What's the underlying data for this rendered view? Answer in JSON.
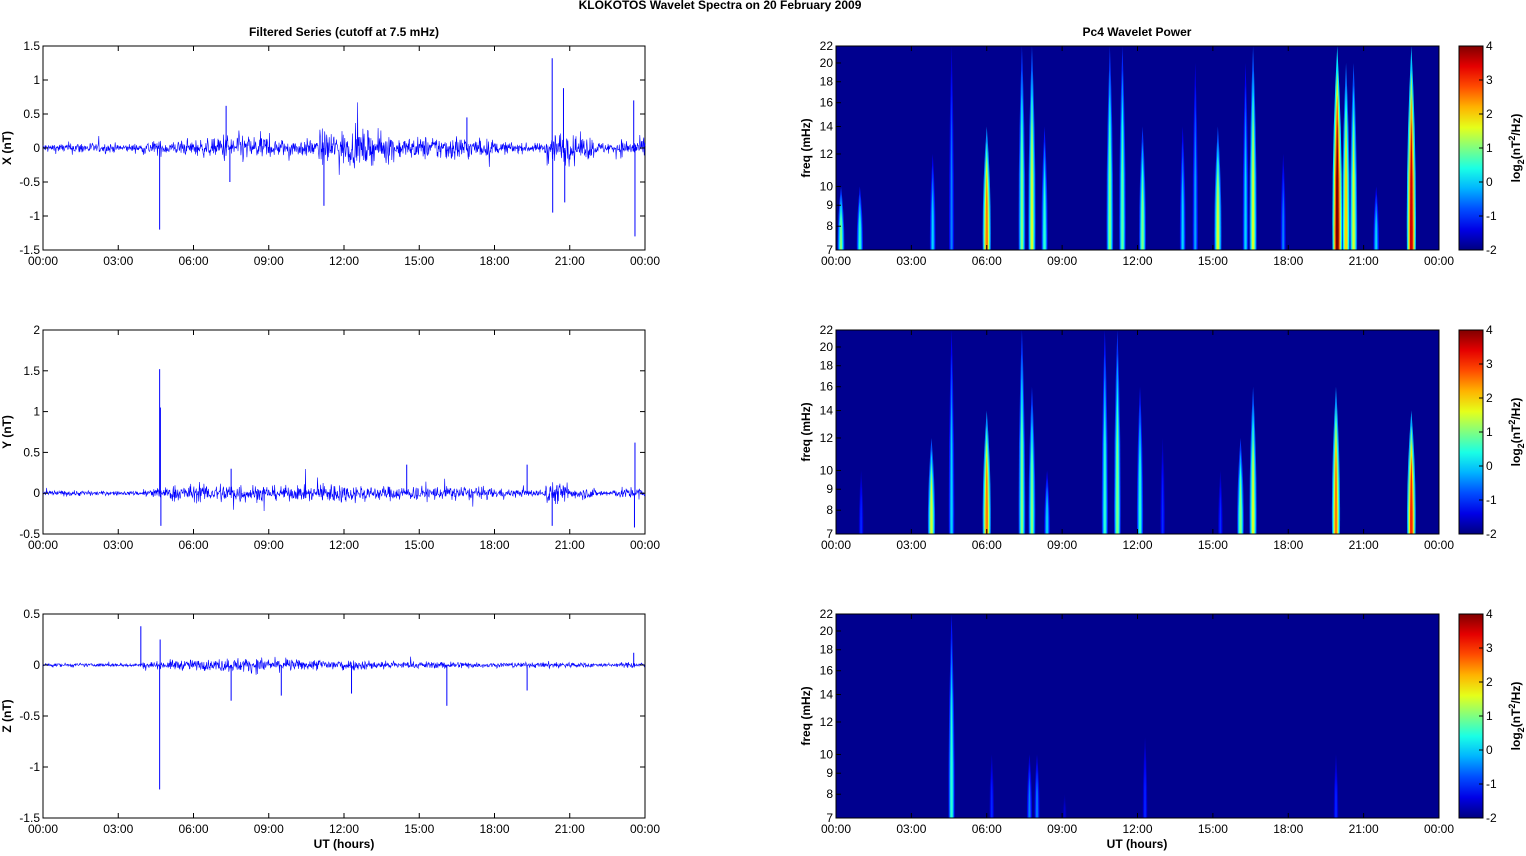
{
  "title": "KLOKOTOS Wavelet Spectra on 20 February  2009",
  "left_title": "Filtered Series (cutoff at 7.5 mHz)",
  "right_title": "Pc4 Wavelet Power",
  "xlabel": "UT (hours)",
  "freq_label": "freq (mHz)",
  "colorbar_label": {
    "a": "log",
    "sub": "2",
    "b": "(nT",
    "sup": "2",
    "c": "/Hz)"
  },
  "colors": {
    "series": "#0000ff",
    "background": "#00008f"
  },
  "chart_data": [
    {
      "type": "line",
      "name": "X",
      "ylabel": "X (nT)",
      "ylim": [
        -1.5,
        1.5
      ],
      "yticks": [
        "-1.5",
        "-1",
        "-0.5",
        "0",
        "0.5",
        "1",
        "1.5"
      ],
      "ytick_values": [
        -1.5,
        -1,
        -0.5,
        0,
        0.5,
        1,
        1.5
      ],
      "xlim": [
        0,
        24
      ],
      "xticks": [
        "00:00",
        "03:00",
        "06:00",
        "09:00",
        "12:00",
        "15:00",
        "18:00",
        "21:00",
        "00:00"
      ],
      "noise_envelope_by_hour": [
        0.08,
        0.1,
        0.08,
        0.07,
        0.12,
        0.12,
        0.15,
        0.25,
        0.22,
        0.15,
        0.15,
        0.3,
        0.3,
        0.25,
        0.18,
        0.2,
        0.22,
        0.15,
        0.1,
        0.08,
        0.28,
        0.2,
        0.1,
        0.15
      ],
      "spikes": [
        [
          4.65,
          -1.2
        ],
        [
          7.3,
          0.62
        ],
        [
          7.45,
          -0.5
        ],
        [
          11.2,
          -0.85
        ],
        [
          16.9,
          0.45
        ],
        [
          20.3,
          1.32
        ],
        [
          20.32,
          -0.95
        ],
        [
          20.75,
          0.88
        ],
        [
          20.8,
          -0.8
        ],
        [
          23.55,
          0.7
        ],
        [
          23.6,
          -1.3
        ]
      ]
    },
    {
      "type": "line",
      "name": "Y",
      "ylabel": "Y (nT)",
      "ylim": [
        -0.5,
        2
      ],
      "yticks": [
        "-0.5",
        "0",
        "0.5",
        "1",
        "1.5",
        "2"
      ],
      "ytick_values": [
        -0.5,
        0,
        0.5,
        1,
        1.5,
        2
      ],
      "xlim": [
        0,
        24
      ],
      "xticks": [
        "00:00",
        "03:00",
        "06:00",
        "09:00",
        "12:00",
        "15:00",
        "18:00",
        "21:00",
        "00:00"
      ],
      "noise_envelope_by_hour": [
        0.04,
        0.04,
        0.03,
        0.03,
        0.08,
        0.12,
        0.12,
        0.15,
        0.12,
        0.1,
        0.1,
        0.15,
        0.12,
        0.1,
        0.1,
        0.1,
        0.1,
        0.08,
        0.06,
        0.05,
        0.15,
        0.08,
        0.05,
        0.08
      ],
      "spikes": [
        [
          4.65,
          1.52
        ],
        [
          4.68,
          1.05
        ],
        [
          4.7,
          -0.4
        ],
        [
          7.5,
          0.3
        ],
        [
          14.5,
          0.35
        ],
        [
          19.3,
          0.35
        ],
        [
          20.3,
          -0.4
        ],
        [
          23.6,
          0.62
        ],
        [
          23.58,
          -0.42
        ]
      ]
    },
    {
      "type": "line",
      "name": "Z",
      "ylabel": "Z (nT)",
      "ylim": [
        -1.5,
        0.5
      ],
      "yticks": [
        "-1.5",
        "-1",
        "-0.5",
        "0",
        "0.5"
      ],
      "ytick_values": [
        -1.5,
        -1,
        -0.5,
        0,
        0.5
      ],
      "xlim": [
        0,
        24
      ],
      "xticks": [
        "00:00",
        "03:00",
        "06:00",
        "09:00",
        "12:00",
        "15:00",
        "18:00",
        "21:00",
        "00:00"
      ],
      "noise_envelope_by_hour": [
        0.02,
        0.02,
        0.02,
        0.02,
        0.04,
        0.06,
        0.06,
        0.08,
        0.08,
        0.07,
        0.06,
        0.07,
        0.06,
        0.05,
        0.04,
        0.04,
        0.04,
        0.03,
        0.03,
        0.03,
        0.04,
        0.03,
        0.02,
        0.03
      ],
      "spikes": [
        [
          3.9,
          0.38
        ],
        [
          4.65,
          -1.22
        ],
        [
          4.67,
          0.25
        ],
        [
          7.5,
          -0.35
        ],
        [
          9.5,
          -0.3
        ],
        [
          12.3,
          -0.28
        ],
        [
          16.1,
          -0.4
        ],
        [
          19.3,
          -0.25
        ],
        [
          23.55,
          0.12
        ]
      ]
    },
    {
      "type": "heatmap",
      "name": "X power",
      "ylabel": "freq (mHz)",
      "yscale": "log",
      "ylim": [
        7,
        22
      ],
      "yticks": [
        "7",
        "8",
        "9",
        "10",
        "12",
        "14",
        "16",
        "18",
        "20",
        "22"
      ],
      "ytick_values": [
        7,
        8,
        9,
        10,
        12,
        14,
        16,
        18,
        20,
        22
      ],
      "clim": [
        -2,
        4
      ],
      "cticks": [
        "-2",
        "-1",
        "0",
        "1",
        "2",
        "3",
        "4"
      ],
      "ctick_values": [
        -2,
        -1,
        0,
        1,
        2,
        3,
        4
      ],
      "xticks": [
        "00:00",
        "03:00",
        "06:00",
        "09:00",
        "12:00",
        "15:00",
        "18:00",
        "21:00",
        "00:00"
      ],
      "bursts": [
        [
          0.2,
          10,
          1
        ],
        [
          0.95,
          10,
          0.5
        ],
        [
          3.85,
          12,
          0
        ],
        [
          4.6,
          22,
          -0.5
        ],
        [
          6.0,
          14,
          2.5
        ],
        [
          7.4,
          22,
          1
        ],
        [
          7.8,
          22,
          1.5
        ],
        [
          8.3,
          14,
          0.5
        ],
        [
          10.9,
          22,
          1
        ],
        [
          11.4,
          22,
          0.8
        ],
        [
          12.2,
          14,
          1
        ],
        [
          13.8,
          14,
          0
        ],
        [
          14.3,
          20,
          -0.3
        ],
        [
          15.2,
          14,
          1.5
        ],
        [
          16.3,
          20,
          0
        ],
        [
          16.6,
          22,
          1.5
        ],
        [
          17.8,
          12,
          -0.5
        ],
        [
          19.95,
          22,
          4
        ],
        [
          20.3,
          20,
          2
        ],
        [
          20.6,
          20,
          1.5
        ],
        [
          21.5,
          10,
          0
        ],
        [
          22.9,
          22,
          3.5
        ]
      ]
    },
    {
      "type": "heatmap",
      "name": "Y power",
      "ylabel": "freq (mHz)",
      "yscale": "log",
      "ylim": [
        7,
        22
      ],
      "yticks": [
        "7",
        "8",
        "9",
        "10",
        "12",
        "14",
        "16",
        "18",
        "20",
        "22"
      ],
      "ytick_values": [
        7,
        8,
        9,
        10,
        12,
        14,
        16,
        18,
        20,
        22
      ],
      "clim": [
        -2,
        4
      ],
      "cticks": [
        "-2",
        "-1",
        "0",
        "1",
        "2",
        "3",
        "4"
      ],
      "ctick_values": [
        -2,
        -1,
        0,
        1,
        2,
        3,
        4
      ],
      "xticks": [
        "00:00",
        "03:00",
        "06:00",
        "09:00",
        "12:00",
        "15:00",
        "18:00",
        "21:00",
        "00:00"
      ],
      "bursts": [
        [
          1.0,
          10,
          -1
        ],
        [
          3.8,
          12,
          1.5
        ],
        [
          4.6,
          22,
          0
        ],
        [
          6.0,
          14,
          2.5
        ],
        [
          7.4,
          22,
          1
        ],
        [
          7.8,
          16,
          1
        ],
        [
          8.4,
          10,
          0
        ],
        [
          10.7,
          22,
          0.5
        ],
        [
          11.2,
          22,
          1
        ],
        [
          12.1,
          16,
          0.5
        ],
        [
          13.0,
          12,
          -1
        ],
        [
          15.3,
          10,
          -1
        ],
        [
          16.1,
          12,
          1
        ],
        [
          16.6,
          16,
          1.5
        ],
        [
          19.9,
          16,
          2.5
        ],
        [
          22.9,
          14,
          3
        ]
      ]
    },
    {
      "type": "heatmap",
      "name": "Z power",
      "ylabel": "freq (mHz)",
      "yscale": "log",
      "ylim": [
        7,
        22
      ],
      "yticks": [
        "7",
        "8",
        "9",
        "10",
        "12",
        "14",
        "16",
        "18",
        "20",
        "22"
      ],
      "ytick_values": [
        7,
        8,
        9,
        10,
        12,
        14,
        16,
        18,
        20,
        22
      ],
      "clim": [
        -2,
        4
      ],
      "cticks": [
        "-2",
        "-1",
        "0",
        "1",
        "2",
        "3",
        "4"
      ],
      "ctick_values": [
        -2,
        -1,
        0,
        1,
        2,
        3,
        4
      ],
      "xticks": [
        "00:00",
        "03:00",
        "06:00",
        "09:00",
        "12:00",
        "15:00",
        "18:00",
        "21:00",
        "00:00"
      ],
      "bursts": [
        [
          4.6,
          22,
          0.5
        ],
        [
          6.2,
          10,
          -1
        ],
        [
          7.7,
          10,
          -0.5
        ],
        [
          8.0,
          10,
          -0.5
        ],
        [
          9.1,
          8,
          -1.5
        ],
        [
          12.3,
          11,
          -1
        ],
        [
          19.9,
          10,
          -1
        ]
      ]
    }
  ]
}
